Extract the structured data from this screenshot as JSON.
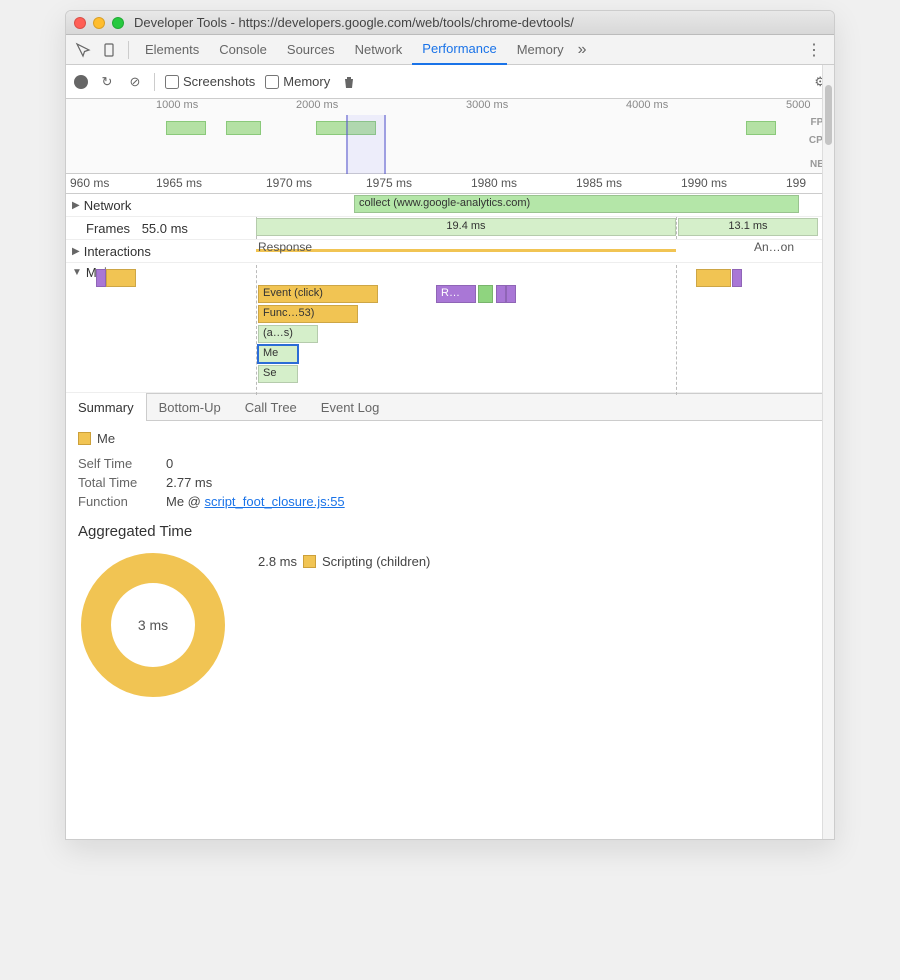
{
  "titlebar": "Developer Tools - https://developers.google.com/web/tools/chrome-devtools/",
  "tabs": [
    "Elements",
    "Console",
    "Sources",
    "Network",
    "Performance",
    "Memory"
  ],
  "active_tab": 4,
  "toolbar": {
    "screenshots": "Screenshots",
    "memory": "Memory"
  },
  "overview": {
    "ticks": [
      "1000 ms",
      "2000 ms",
      "3000 ms",
      "4000 ms",
      "5000"
    ],
    "labels": [
      "FPS",
      "CPU",
      "NET"
    ]
  },
  "detail_ruler": [
    "960 ms",
    "1965 ms",
    "1970 ms",
    "1975 ms",
    "1980 ms",
    "1985 ms",
    "1990 ms",
    "199"
  ],
  "rows": {
    "network": {
      "label": "Network",
      "item": "collect (www.google-analytics.com)"
    },
    "frames": {
      "label": "Frames",
      "value": "55.0 ms",
      "seg1": "19.4 ms",
      "seg2": "13.1 ms"
    },
    "interactions": {
      "label": "Interactions",
      "resp": "Response",
      "anim": "An…on"
    },
    "main": {
      "label": "Main",
      "ev": "Event (click)",
      "func": "Func…53)",
      "a": "(a…s)",
      "me": "Me",
      "se": "Se",
      "r": "R…"
    }
  },
  "detail_tabs": [
    "Summary",
    "Bottom-Up",
    "Call Tree",
    "Event Log"
  ],
  "summary": {
    "name": "Me",
    "self_label": "Self Time",
    "self_val": "0",
    "total_label": "Total Time",
    "total_val": "2.77 ms",
    "func_label": "Function",
    "func_prefix": "Me @ ",
    "func_link": "script_foot_closure.js:55",
    "agg_title": "Aggregated Time",
    "donut_center": "3 ms",
    "legend_val": "2.8 ms",
    "legend_label": "Scripting (children)"
  },
  "chart_data": {
    "type": "pie",
    "title": "Aggregated Time",
    "series": [
      {
        "name": "Scripting (children)",
        "value": 2.8,
        "color": "#f1c453"
      }
    ],
    "total_label": "3 ms"
  }
}
